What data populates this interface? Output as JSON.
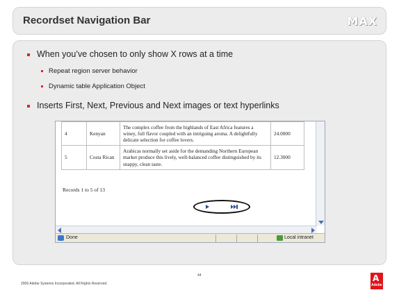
{
  "slide": {
    "title": "Recordset Navigation Bar",
    "brand_logo": "MAX",
    "bullets": [
      {
        "level": 1,
        "text": "When you’ve chosen to only show X rows at a time"
      },
      {
        "level": 2,
        "text": "Repeat region server behavior"
      },
      {
        "level": 2,
        "text": "Dynamic table Application Object"
      },
      {
        "level": 1,
        "text": "Inserts First, Next, Previous and Next images or text hyperlinks"
      }
    ],
    "footer": {
      "copyright": "2006 Adobe Systems Incorporated. All Rights Reserved.",
      "page_number": "44",
      "adobe_logo_text": "Adobe"
    }
  },
  "browser": {
    "table_rows": [
      {
        "id": "4",
        "name": "Kenyan",
        "description": "The complex coffee from the highlands of East Africa features a winey, full flavor coupled with an intriguing aroma. A delightfully delicate selection for coffee lovers.",
        "price": "24.0000"
      },
      {
        "id": "5",
        "name": "Costa Rican",
        "description": "Arabicas normally set aside for the demanding Northern European market produce this lively, well-balanced coffee distinguished by its snappy, clean taste.",
        "price": "12.3000"
      }
    ],
    "records_text": "Records 1 to 5 of 13",
    "nav_icons": [
      "next-arrow-icon",
      "last-arrow-icon"
    ],
    "status": {
      "left": "Done",
      "right": "Local intranet"
    }
  },
  "colors": {
    "bullet": "#d8262e",
    "panel": "#ececec",
    "adobe_red": "#e0151c"
  }
}
